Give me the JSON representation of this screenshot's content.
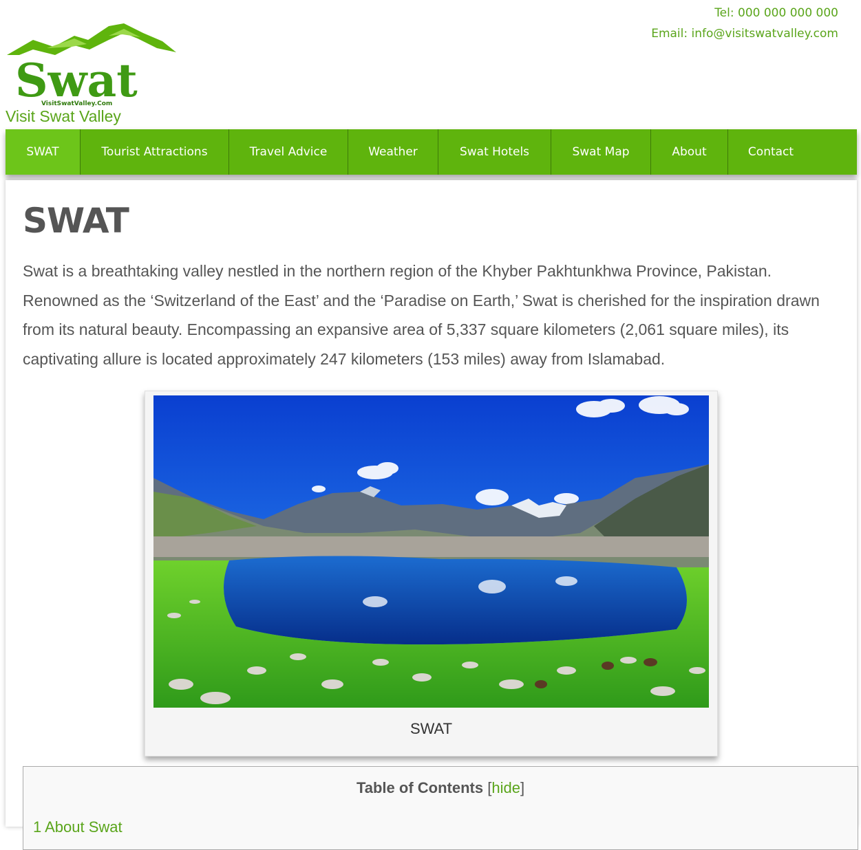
{
  "header": {
    "tel": "Tel: 000 000 000 000",
    "email_prefix": "Email: ",
    "email": "info@visitswatvalley.com",
    "logo_text": "Swat",
    "logo_subtext": "VisitSwatValley.Com",
    "tagline": "Visit Swat Valley"
  },
  "nav": {
    "items": [
      {
        "label": "SWAT"
      },
      {
        "label": "Tourist Attractions"
      },
      {
        "label": "Travel Advice"
      },
      {
        "label": "Weather"
      },
      {
        "label": "Swat Hotels"
      },
      {
        "label": "Swat Map"
      },
      {
        "label": "About"
      },
      {
        "label": "Contact"
      }
    ],
    "active_index": 0
  },
  "main": {
    "title": "SWAT",
    "intro": "Swat is a breathtaking valley nestled in the northern region of the Khyber Pakhtunkhwa Province, Pakistan. Renowned as the ‘Switzerland of the East’ and the ‘Paradise on Earth,’ Swat is cherished for the inspiration drawn from its natural beauty. Encompassing an expansive area of 5,337 square kilometers (2,061 square miles), its captivating allure is located approximately 247 kilometers (153 miles) away from Islamabad.",
    "figure_caption": "SWAT"
  },
  "toc": {
    "title": "Table of Contents",
    "bracket_open": "[",
    "toggle": "hide",
    "bracket_close": "]",
    "items": [
      "1 About Swat"
    ]
  },
  "colors": {
    "brand_green": "#5fb40d",
    "link_green": "#5aa51b",
    "text_gray": "#555555"
  }
}
